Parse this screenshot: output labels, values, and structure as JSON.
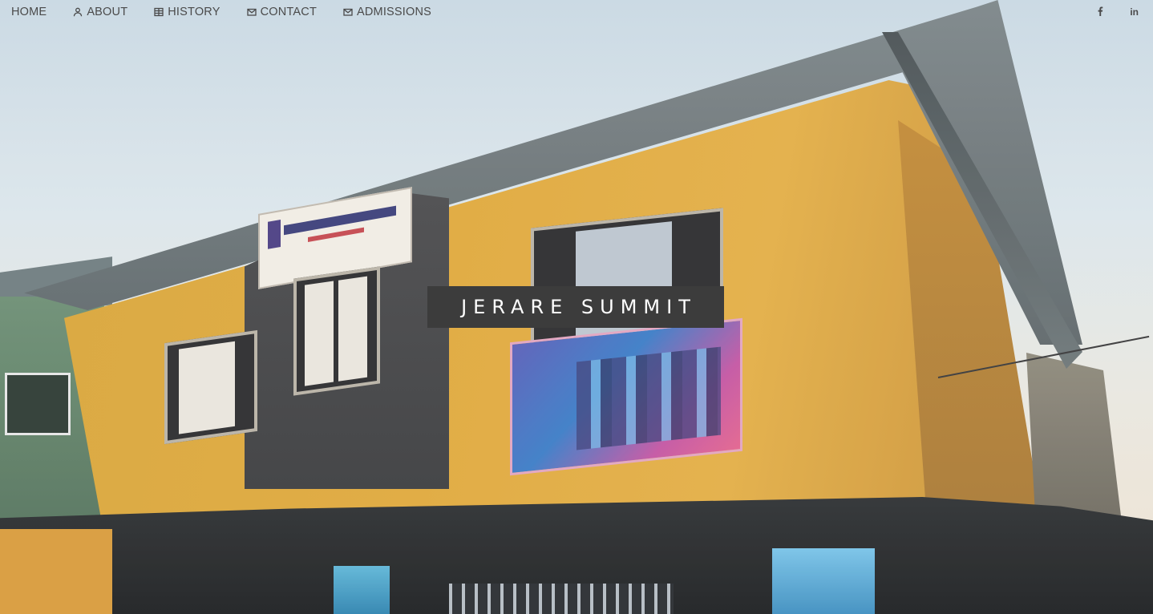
{
  "nav": {
    "items": [
      {
        "label": "HOME",
        "icon": ""
      },
      {
        "label": "ABOUT",
        "icon": "user-icon"
      },
      {
        "label": "HISTORY",
        "icon": "table-icon"
      },
      {
        "label": "CONTACT",
        "icon": "envelope-icon"
      },
      {
        "label": "ADMISSIONS",
        "icon": "envelope-icon"
      }
    ],
    "social": [
      {
        "icon": "facebook-icon"
      },
      {
        "icon": "linkedin-icon",
        "label": "in"
      }
    ]
  },
  "hero": {
    "title": "JERARE SUMMIT",
    "image": "school-building-photo"
  },
  "colors": {
    "nav_text": "#4a4a4a",
    "title_bg": "#3c3c3c",
    "title_text": "#ffffff"
  }
}
